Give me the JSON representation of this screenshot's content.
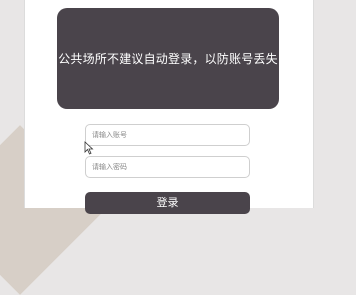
{
  "notice": {
    "text": "公共场所不建议自动登录，以防账号丢失"
  },
  "login_form": {
    "account_placeholder": "请输入账号",
    "password_placeholder": "请输入密码",
    "submit_label": "登录"
  },
  "colors": {
    "panel_dark": "#4a444b",
    "page_bg": "#e8e6e6",
    "input_border": "#cfcfcf"
  },
  "icons": {
    "pointer": "mouse-cursor-icon"
  }
}
